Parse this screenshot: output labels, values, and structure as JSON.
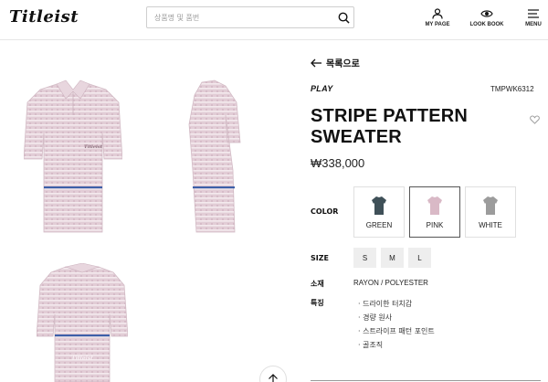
{
  "header": {
    "logo": "Titleist",
    "search_placeholder": "상품명 및 품번",
    "nav": [
      {
        "label": "MY PAGE",
        "icon": "user-icon"
      },
      {
        "label": "LOOK BOOK",
        "icon": "eye-icon"
      },
      {
        "label": "MENU",
        "icon": "hamburger-icon"
      }
    ]
  },
  "gallery": {
    "images": [
      {
        "view": "front",
        "print": "Titleist"
      },
      {
        "view": "side"
      },
      {
        "view": "back",
        "print": "Titleist"
      }
    ],
    "colors": {
      "base": "#e2cdd6",
      "stripe": "#f4eaee",
      "band": "#3d5fa8"
    }
  },
  "product": {
    "back_label": "목록으로",
    "brand": "PLAY",
    "code": "TMPWK6312",
    "title": "STRIPE PATTERN SWEATER",
    "price": "₩338,000",
    "color_label": "COLOR",
    "colors": [
      {
        "name": "GREEN",
        "swatch": "#3f5058",
        "selected": false
      },
      {
        "name": "PINK",
        "swatch": "#d9b9c6",
        "selected": true
      },
      {
        "name": "WHITE",
        "swatch": "#9c9c9c",
        "selected": false
      }
    ],
    "size_label": "SIZE",
    "sizes": [
      "S",
      "M",
      "L"
    ],
    "material_label": "소재",
    "material": "RAYON / POLYESTER",
    "features_label": "특징",
    "features": [
      "· 드라이한 터치감",
      "· 경량 원사",
      "· 스트라이프 패턴 포인트",
      "· 골조직"
    ]
  }
}
